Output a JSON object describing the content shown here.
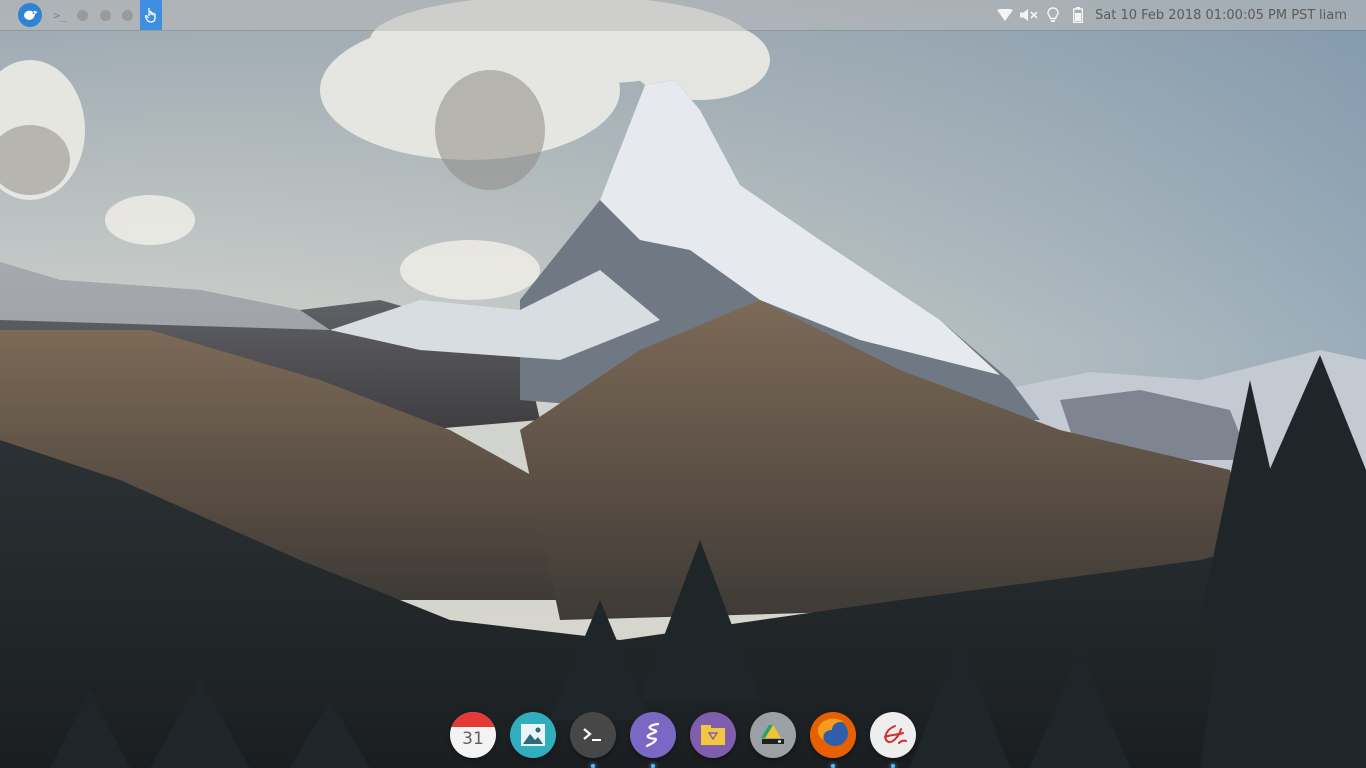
{
  "top_panel": {
    "terminal_glyph": ">_",
    "clock": "Sat 10 Feb 2018 01:00:05 PM PST",
    "user": "liam",
    "accent": "#3f8fe0"
  },
  "icons": {
    "launcher": "bird-launcher-icon",
    "indicators": [
      "wifi-icon",
      "volume-muted-icon",
      "lightbulb-icon",
      "battery-icon"
    ]
  },
  "dock": {
    "calendar_day": "31",
    "apps": [
      "calendar",
      "photos",
      "terminal",
      "emacs",
      "archive-manager",
      "drive",
      "firefox",
      "document-reader"
    ],
    "running_indicator_color": "#55b8ff"
  }
}
